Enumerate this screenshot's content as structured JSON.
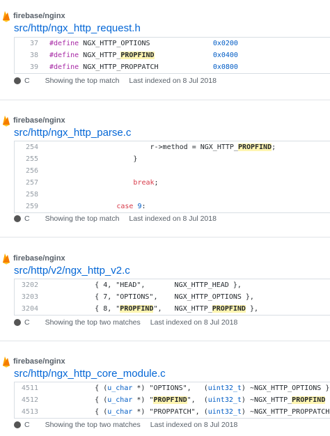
{
  "results": [
    {
      "repo": "firebase/nginx",
      "file": "src/http/ngx_http_request.h",
      "lines": [
        {
          "num": "37",
          "segments": [
            {
              "t": "#define ",
              "c": "kw"
            },
            {
              "t": "NGX_HTTP_OPTIONS",
              "c": ""
            },
            {
              "t": "               ",
              "c": ""
            },
            {
              "t": "0x0200",
              "c": "num"
            }
          ]
        },
        {
          "num": "38",
          "segments": [
            {
              "t": "#define ",
              "c": "kw"
            },
            {
              "t": "NGX_HTTP_",
              "c": ""
            },
            {
              "t": "PROPFIND",
              "c": "hl"
            },
            {
              "t": "              ",
              "c": ""
            },
            {
              "t": "0x0400",
              "c": "num"
            }
          ]
        },
        {
          "num": "39",
          "segments": [
            {
              "t": "#define ",
              "c": "kw"
            },
            {
              "t": "NGX_HTTP_PROPPATCH",
              "c": ""
            },
            {
              "t": "             ",
              "c": ""
            },
            {
              "t": "0x0800",
              "c": "num"
            }
          ]
        }
      ],
      "language": "C",
      "summary": "Showing the top match",
      "indexed": "Last indexed on 8 Jul 2018"
    },
    {
      "repo": "firebase/nginx",
      "file": "src/http/ngx_http_parse.c",
      "lines": [
        {
          "num": "254",
          "segments": [
            {
              "t": "                        r->method = NGX_HTTP_",
              "c": ""
            },
            {
              "t": "PROPFIND",
              "c": "hl"
            },
            {
              "t": ";",
              "c": ""
            }
          ]
        },
        {
          "num": "255",
          "segments": [
            {
              "t": "                    }",
              "c": ""
            }
          ]
        },
        {
          "num": "256",
          "segments": [
            {
              "t": "",
              "c": ""
            }
          ]
        },
        {
          "num": "257",
          "segments": [
            {
              "t": "                    ",
              "c": ""
            },
            {
              "t": "break",
              "c": "kwr"
            },
            {
              "t": ";",
              "c": ""
            }
          ]
        },
        {
          "num": "258",
          "segments": [
            {
              "t": "",
              "c": ""
            }
          ]
        },
        {
          "num": "259",
          "segments": [
            {
              "t": "                ",
              "c": ""
            },
            {
              "t": "case",
              "c": "kwr"
            },
            {
              "t": " ",
              "c": ""
            },
            {
              "t": "9",
              "c": "num"
            },
            {
              "t": ":",
              "c": ""
            }
          ]
        }
      ],
      "language": "C",
      "summary": "Showing the top match",
      "indexed": "Last indexed on 8 Jul 2018"
    },
    {
      "repo": "firebase/nginx",
      "file": "src/http/v2/ngx_http_v2.c",
      "lines": [
        {
          "num": "3202",
          "segments": [
            {
              "t": "        { 4, \"HEAD\",       NGX_HTTP_HEAD },",
              "c": ""
            }
          ]
        },
        {
          "num": "3203",
          "segments": [
            {
              "t": "        { 7, \"OPTIONS\",    NGX_HTTP_OPTIONS },",
              "c": ""
            }
          ]
        },
        {
          "num": "3204",
          "segments": [
            {
              "t": "        { 8, \"",
              "c": ""
            },
            {
              "t": "PROPFIND",
              "c": "hl"
            },
            {
              "t": "\",   NGX_HTTP_",
              "c": ""
            },
            {
              "t": "PROPFIND",
              "c": "hl"
            },
            {
              "t": " },",
              "c": ""
            }
          ]
        }
      ],
      "language": "C",
      "summary": "Showing the top two matches",
      "indexed": "Last indexed on 8 Jul 2018"
    },
    {
      "repo": "firebase/nginx",
      "file": "src/http/ngx_http_core_module.c",
      "lines": [
        {
          "num": "4511",
          "segments": [
            {
              "t": "        { (",
              "c": ""
            },
            {
              "t": "u_char",
              "c": "num"
            },
            {
              "t": " *) \"OPTIONS\",   (",
              "c": ""
            },
            {
              "t": "uint32_t",
              "c": "num"
            },
            {
              "t": ") ~NGX_HTTP_OPTIONS },",
              "c": ""
            }
          ]
        },
        {
          "num": "4512",
          "segments": [
            {
              "t": "        { (",
              "c": ""
            },
            {
              "t": "u_char",
              "c": "num"
            },
            {
              "t": " *) \"",
              "c": ""
            },
            {
              "t": "PROPFIND",
              "c": "hl"
            },
            {
              "t": "\",  (",
              "c": ""
            },
            {
              "t": "uint32_t",
              "c": "num"
            },
            {
              "t": ") ~NGX_HTTP_",
              "c": ""
            },
            {
              "t": "PROPFIND",
              "c": "hl"
            },
            {
              "t": " },",
              "c": ""
            }
          ]
        },
        {
          "num": "4513",
          "segments": [
            {
              "t": "        { (",
              "c": ""
            },
            {
              "t": "u_char",
              "c": "num"
            },
            {
              "t": " *) \"PROPPATCH\", (",
              "c": ""
            },
            {
              "t": "uint32_t",
              "c": "num"
            },
            {
              "t": ") ~NGX_HTTP_PROPPATCH },",
              "c": ""
            }
          ]
        }
      ],
      "language": "C",
      "summary": "Showing the top two matches",
      "indexed": "Last indexed on 8 Jul 2018"
    }
  ],
  "colors": {
    "link": "#0366d6",
    "highlight": "#fff5b1",
    "language_dot": "#555555",
    "keyword": "#a626a4",
    "number": "#005cc5"
  },
  "icons": {
    "repo": "firebase-flame-icon"
  }
}
